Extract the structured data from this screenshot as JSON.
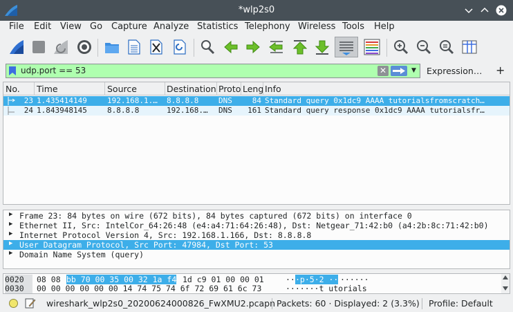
{
  "window": {
    "title": "*wlp2s0"
  },
  "menu": [
    "File",
    "Edit",
    "View",
    "Go",
    "Capture",
    "Analyze",
    "Statistics",
    "Telephony",
    "Wireless",
    "Tools",
    "Help"
  ],
  "toolbar": {
    "icons": [
      "shark-fin-start-icon",
      "stop-icon",
      "restart-icon",
      "capture-options-gear-icon",
      "open-folder-icon",
      "save-file-icon",
      "close-file-icon",
      "reload-icon",
      "find-packet-icon",
      "go-back-icon",
      "go-forward-icon",
      "go-to-packet-icon",
      "go-first-icon",
      "go-last-icon",
      "auto-scroll-icon",
      "colorize-icon",
      "zoom-in-icon",
      "zoom-out-icon",
      "normal-size-icon",
      "resize-columns-icon"
    ]
  },
  "filter": {
    "value": "udp.port == 53",
    "expression_label": "Expression…",
    "plus_label": "+",
    "clear_glyph": "✕"
  },
  "packet_list": {
    "columns": [
      "No.",
      "Time",
      "Source",
      "Destination",
      "Proto",
      "Leng",
      "Info"
    ],
    "rows": [
      {
        "no": "23",
        "time": "1.435414149",
        "source": "192.168.1.…",
        "destination": "8.8.8.8",
        "proto": "DNS",
        "length": "84",
        "info": "Standard query 0x1dc9 AAAA tutorialsfromscratch…",
        "selected": true
      },
      {
        "no": "24",
        "time": "1.843948145",
        "source": "8.8.8.8",
        "destination": "192.168.…",
        "proto": "DNS",
        "length": "161",
        "info": "Standard query response 0x1dc9 AAAA tutorialsfr…",
        "selected": false
      }
    ]
  },
  "details": [
    {
      "text": "Frame 23: 84 bytes on wire (672 bits), 84 bytes captured (672 bits) on interface 0",
      "selected": false
    },
    {
      "text": "Ethernet II, Src: IntelCor_64:26:48 (e4:a4:71:64:26:48), Dst: Netgear_71:42:b0 (a4:2b:8c:71:42:b0)",
      "selected": false
    },
    {
      "text": "Internet Protocol Version 4, Src: 192.168.1.166, Dst: 8.8.8.8",
      "selected": false
    },
    {
      "text": "User Datagram Protocol, Src Port: 47984, Dst Port: 53",
      "selected": true
    },
    {
      "text": "Domain Name System (query)",
      "selected": false
    }
  ],
  "bytes": [
    {
      "offset": "0020",
      "hex_pre": "08 08 ",
      "hex_hl": "bb 70 00 35 00 32  1a f4",
      "hex_post": " 1d c9 01 00 00 01",
      "ascii_pre": "··",
      "ascii_hl": "·p·5·2 ··",
      "ascii_post": "······"
    },
    {
      "offset": "0030",
      "hex_pre": "00 00 00 00 00 00 14 74  75 74 6f 72 69 61 6c 73",
      "hex_hl": "",
      "hex_post": "",
      "ascii_pre": "·······t utorials",
      "ascii_hl": "",
      "ascii_post": ""
    }
  ],
  "status": {
    "file": "wireshark_wlp2s0_20200624000826_FwXMU2.pcapn",
    "packets": "Packets: 60 · Displayed: 2 (3.3%)",
    "profile": "Profile: Default"
  },
  "colors": {
    "selection": "#3daee9",
    "filter_valid": "#afffaf",
    "titlebar": "#475057"
  }
}
